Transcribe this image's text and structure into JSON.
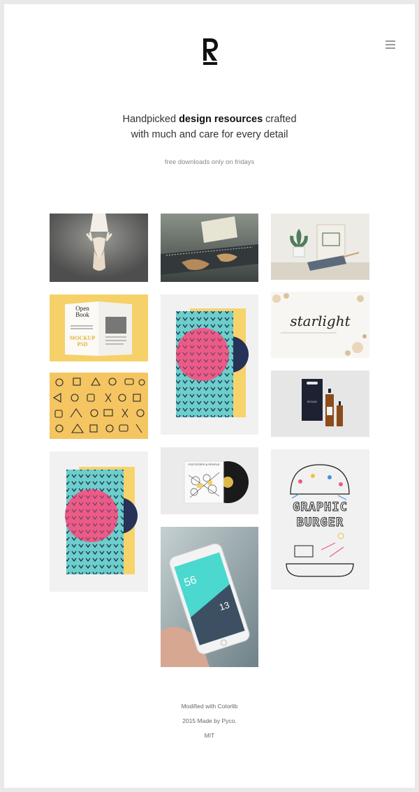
{
  "header": {
    "logo_icon": "r-monogram-logo",
    "menu_icon": "hamburger-menu-icon"
  },
  "hero": {
    "line1_pre": "Handpicked ",
    "line1_bold": "design resources",
    "line1_post": " crafted",
    "line2": "with much and care for every detail",
    "subtitle": "free downloads only on fridays"
  },
  "gallery": {
    "open_book": {
      "title_line1": "Open",
      "title_line2": "Book",
      "mockup_line1": "MOCKUP",
      "mockup_line2": "PSD"
    },
    "starlight": {
      "title": "starlight"
    },
    "vinyl": {
      "label": "FOOTSTEPS & PEOPLE"
    },
    "phone": {
      "big_number": "56",
      "small_number": "13"
    },
    "bottle": {
      "brand": "BYDAG"
    },
    "graphic_burger": {
      "line1": "GRAPHIC",
      "line2": "BURGER"
    }
  },
  "footer": {
    "credit": "Modified with Colorlib",
    "made_by": "2015 Made by Pyco.",
    "license": "MIT"
  },
  "colors": {
    "page_bg": "#e9e9e9",
    "card_bg": "#f1f1f1",
    "teal": "#6ccfc9",
    "pink": "#ec5b86",
    "yellow": "#f6d36b"
  }
}
